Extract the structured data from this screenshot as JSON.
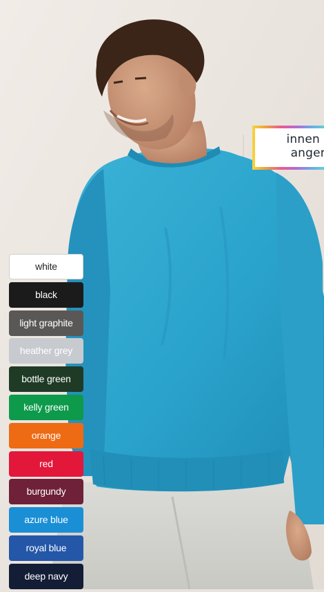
{
  "promo": {
    "line1": "innen",
    "line2": "anger"
  },
  "colors": [
    {
      "label": "white",
      "bg": "#ffffff",
      "fg": "#222222"
    },
    {
      "label": "black",
      "bg": "#1b1b1b",
      "fg": "#ffffff"
    },
    {
      "label": "light graphite",
      "bg": "#5a5857",
      "fg": "#ffffff"
    },
    {
      "label": "heather grey",
      "bg": "#c7cbd0",
      "fg": "#ffffff"
    },
    {
      "label": "bottle green",
      "bg": "#1f3b26",
      "fg": "#ffffff"
    },
    {
      "label": "kelly green",
      "bg": "#0e9a4b",
      "fg": "#ffffff"
    },
    {
      "label": "orange",
      "bg": "#ee6a13",
      "fg": "#ffffff"
    },
    {
      "label": "red",
      "bg": "#e3173a",
      "fg": "#ffffff"
    },
    {
      "label": "burgundy",
      "bg": "#6e2138",
      "fg": "#ffffff"
    },
    {
      "label": "azure blue",
      "bg": "#1a8fd6",
      "fg": "#ffffff"
    },
    {
      "label": "royal blue",
      "bg": "#2457a8",
      "fg": "#ffffff"
    },
    {
      "label": "deep navy",
      "bg": "#141d36",
      "fg": "#ffffff"
    }
  ]
}
